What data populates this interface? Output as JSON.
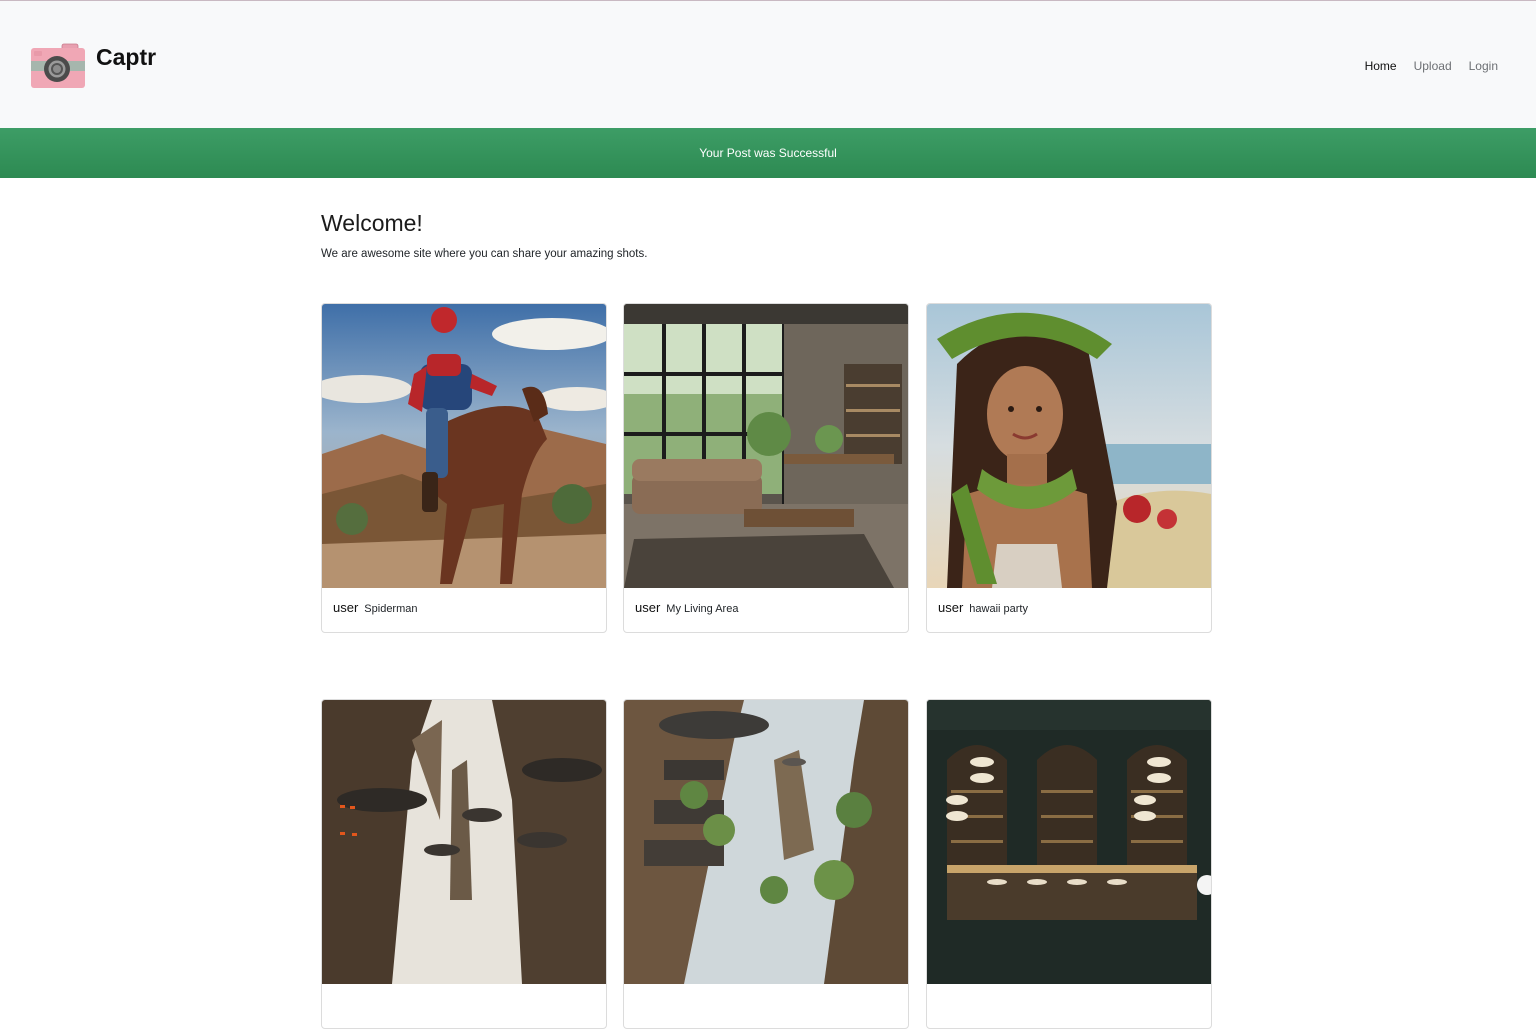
{
  "header": {
    "brand_name": "Captr",
    "nav": [
      {
        "label": "Home",
        "active": true
      },
      {
        "label": "Upload",
        "active": false
      },
      {
        "label": "Login",
        "active": false
      }
    ]
  },
  "alert": {
    "message": "Your Post was Successful",
    "color": "#3a9961"
  },
  "intro": {
    "heading": "Welcome!",
    "text": "We are awesome site where you can share your amazing shots."
  },
  "posts": [
    {
      "author": "user",
      "title": "Spiderman",
      "image": "spiderman-cowboy-on-horse"
    },
    {
      "author": "user",
      "title": "My Living Area",
      "image": "living-room-interior"
    },
    {
      "author": "user",
      "title": "hawaii party",
      "image": "woman-with-lei"
    },
    {
      "author": "",
      "title": "",
      "image": "canyon-city"
    },
    {
      "author": "",
      "title": "",
      "image": "cliff-village"
    },
    {
      "author": "",
      "title": "",
      "image": "bar-interior"
    }
  ]
}
